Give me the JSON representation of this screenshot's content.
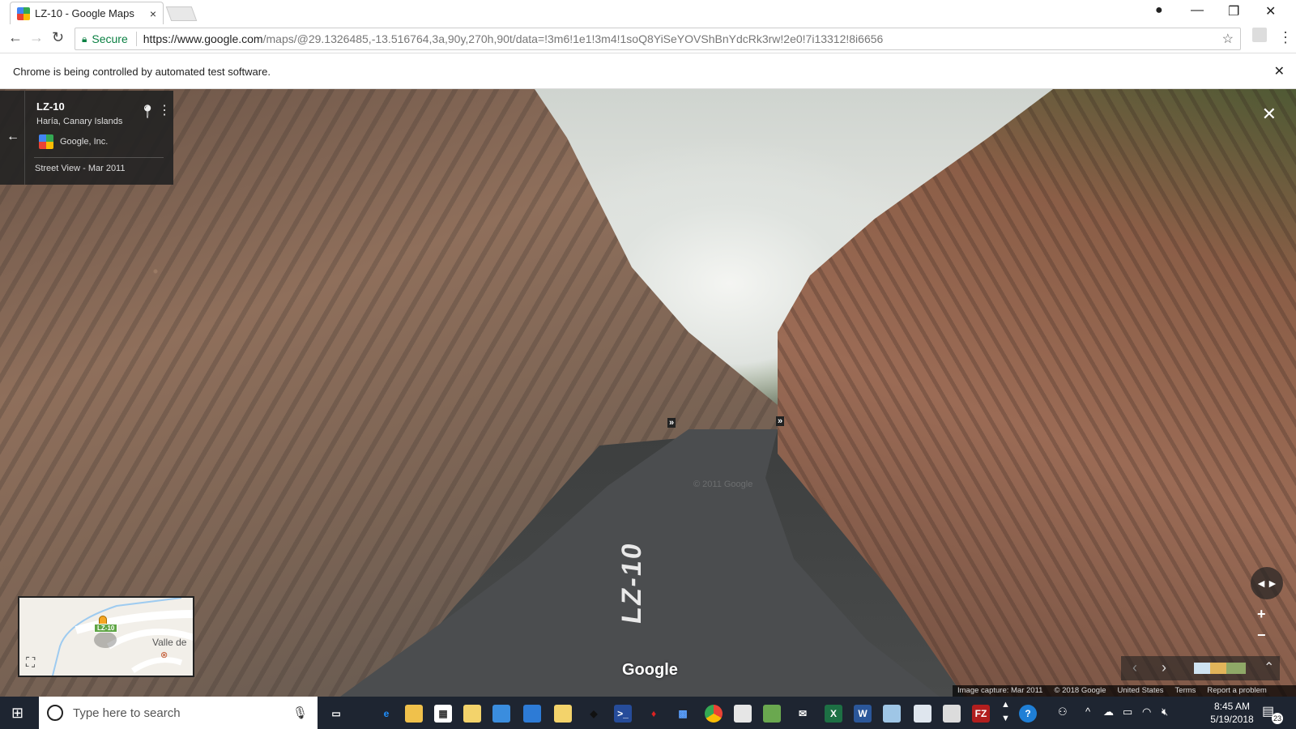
{
  "browser": {
    "tab_title": "LZ-10 - Google Maps",
    "tab_close": "×",
    "window_controls": {
      "account": "●",
      "minimize": "—",
      "restore": "❐",
      "close": "✕"
    },
    "nav": {
      "back": "←",
      "forward": "→",
      "reload": "↻"
    },
    "address": {
      "secure_label": "Secure",
      "host": "https://www.google.com",
      "path": "/maps/@29.1326485,-13.516764,3a,90y,270h,90t/data=!3m6!1e1!3m4!1soQ8YiSeYOVShBnYdcRk3rw!2e0!7i13312!8i6656"
    },
    "bookmark_star": "☆",
    "menu": "⋮",
    "infobar_text": "Chrome is being controlled by automated test software.",
    "infobar_close": "✕"
  },
  "street_view": {
    "place_title": "LZ-10",
    "place_subtitle": "Haría, Canary Islands",
    "author": "Google, Inc.",
    "capture_label": "Street View - Mar 2011",
    "back_arrow": "←",
    "close": "✕",
    "road_marking": "LZ-10",
    "watermark": "© 2011 Google",
    "google_logo": "Google",
    "minimap": {
      "place_label": "Valle de",
      "road_shield": "LZ-10"
    },
    "zoom_in": "+",
    "zoom_out": "−",
    "filmstrip": {
      "prev": "‹",
      "next": "›",
      "collapse": "⌃"
    },
    "footer": {
      "image_capture": "Image capture: Mar 2011",
      "copyright": "© 2018 Google",
      "region": "United States",
      "terms": "Terms",
      "report": "Report a problem"
    }
  },
  "taskbar": {
    "search_placeholder": "Type here to search",
    "time": "8:45 AM",
    "date": "5/19/2018",
    "notification_count": "23"
  }
}
